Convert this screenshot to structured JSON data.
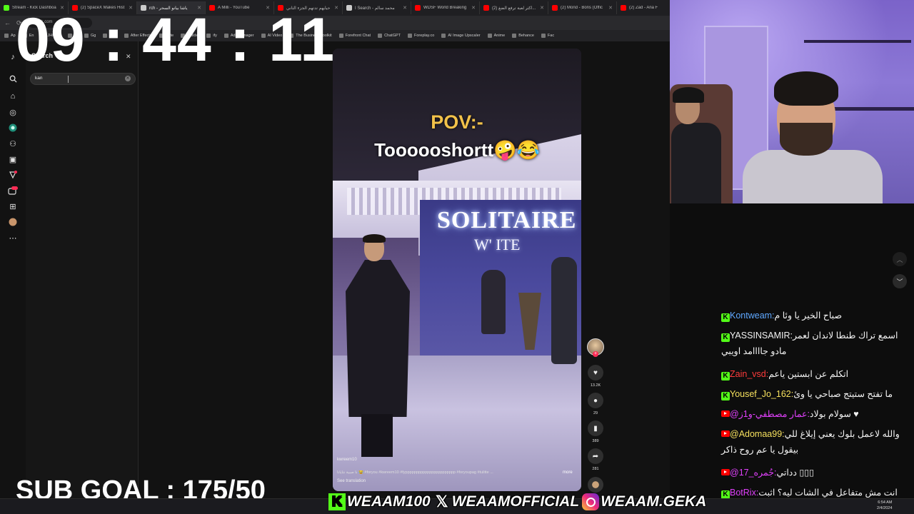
{
  "browser": {
    "tabs": [
      {
        "label": "Stream - Kick Dashboa",
        "color": "#53fc18",
        "active": false
      },
      {
        "label": "(2) SpaceX Makes Hist",
        "color": "#ff0000",
        "active": false
      },
      {
        "label": "rch - ياشا بيانو السحر",
        "color": "#cccccc",
        "active": true
      },
      {
        "label": "A Milli - YouTube",
        "color": "#ff0000",
        "active": false
      },
      {
        "label": "حيايهم تدتهم الجزء الثاني",
        "color": "#ff0000",
        "active": false
      },
      {
        "label": "ا Search - محمد سالم",
        "color": "#cccccc",
        "active": false
      },
      {
        "label": "WDSF World Breaking",
        "color": "#ff0000",
        "active": false
      },
      {
        "label": "(2) اكثر لعبة ترفع الضغ...",
        "color": "#ff0000",
        "active": false
      },
      {
        "label": "(2) Mond - Bons (Offic",
        "color": "#ff0000",
        "active": false
      },
      {
        "label": "(2) Zad - Ana F",
        "color": "#ff0000",
        "active": false
      }
    ],
    "address": "tiktok.com",
    "bookmarks": [
      "Ap",
      "En",
      "JHP - E",
      "Y",
      "Gg",
      "Kick",
      "After Effects",
      "Note",
      "Builder",
      "ify",
      "Ads Manager",
      "AI Video",
      "The Business Toolkit",
      "Forefront Chat",
      "ChatGPT",
      "Foreplay.co",
      "AI Image Upscaler",
      "Anime",
      "Behance",
      "Fac"
    ]
  },
  "search_panel": {
    "title": "Search",
    "query": "kan"
  },
  "nav_icons": [
    "tiktok-logo-icon",
    "search-icon",
    "home-icon",
    "explore-icon",
    "live-icon",
    "following-icon",
    "friends-icon",
    "activity-icon",
    "messages-icon",
    "upload-icon",
    "profile-icon",
    "more-icon"
  ],
  "nav_badges": {
    "activity": "",
    "messages": "99+"
  },
  "video": {
    "pov": "POV:-",
    "caption": "Toooooshortt🤪😂",
    "sign_main": "SOLITAIRE",
    "sign_sub": "W' ITE",
    "author": "kwreem10",
    "description": "نا صبية نتاياتا 😂 #foryou #kwreem10 #fyppppppppppppppppppppppp #foryoupag #tulitte ...",
    "more_label": "more",
    "translate_label": "See translation"
  },
  "actions": {
    "likes": "13.2K",
    "comments": "29",
    "saves": "389",
    "shares": "281"
  },
  "overlay": {
    "timer": "09 : 44 : 11",
    "sub_goal": "SUB GOAL : 175/50",
    "socials": [
      {
        "platform": "kick",
        "handle": "WEAAM100"
      },
      {
        "platform": "x",
        "handle": "WEAAMOFFICIAL"
      },
      {
        "platform": "instagram",
        "handle": "WEAAM.GEKA"
      }
    ]
  },
  "chat": {
    "messages": [
      {
        "platform": "kick",
        "user": "Kontweam:",
        "color": "#5fa8ff",
        "text": "صباح الخير يا وئا م",
        "text2": ""
      },
      {
        "platform": "kick",
        "user": "YASSINSAMIR:",
        "color": "#f2f2f2",
        "text": "اسمع تراك طنطا لاندان لعمر",
        "text2": "مادو جاااامد اويبي"
      },
      {
        "platform": "kick",
        "user": "Zain_vsd:",
        "color": "#ff3b3b",
        "text": "اتكلم عن ابستين ياعم",
        "text2": ""
      },
      {
        "platform": "kick",
        "user": "Yousef_Jo_162:",
        "color": "#f6e05e",
        "text": "ما تفتح ستيتج صباحي يا وئ",
        "text2": ""
      },
      {
        "platform": "youtube",
        "user": "@عمار مصطفي-و1ز:",
        "color": "#e040fb",
        "text": "سولام بولاد ♥",
        "text2": ""
      },
      {
        "platform": "youtube",
        "user": "@Adomaa99:",
        "color": "#f6e05e",
        "text": "والله لاعمل بلوك يعني إيلاغ للي",
        "text2": "بيقول يا عم روح ذاكر"
      },
      {
        "platform": "youtube",
        "user": "@17_جُمره:",
        "color": "#e040fb",
        "text": "دداتي ▯▯▯",
        "text2": ""
      },
      {
        "platform": "kick",
        "user": "BotRix:",
        "color": "#e040fb",
        "text": "انت مش متفاعل في الشات ليه؟ اثبت",
        "text2": ""
      }
    ]
  },
  "taskbar": {
    "time": "6:54 AM",
    "date": "2/4/2024"
  }
}
